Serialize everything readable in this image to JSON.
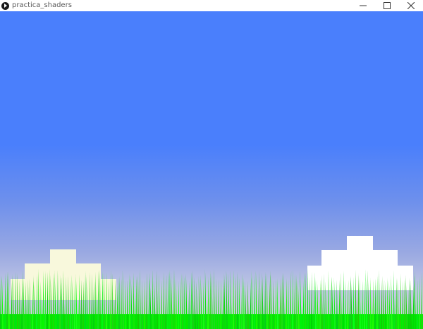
{
  "window": {
    "title": "practica_shaders",
    "app_icon": "processing-play-icon",
    "controls": [
      {
        "name": "minimize",
        "icon": "minimize-icon"
      },
      {
        "name": "maximize",
        "icon": "maximize-icon"
      },
      {
        "name": "close",
        "icon": "close-icon"
      }
    ]
  },
  "scene": {
    "sky_colors": {
      "top": "#4a7ffc",
      "horizon": "#d8d6e4"
    },
    "cloud_left_color": "#f8f8dc",
    "cloud_right_color": "#ffffff",
    "grass_color": "#00ee00"
  }
}
